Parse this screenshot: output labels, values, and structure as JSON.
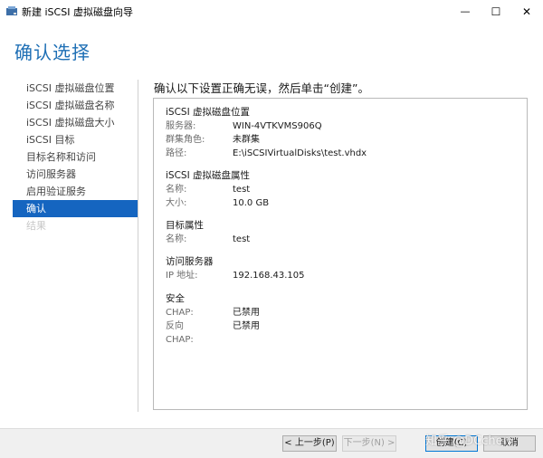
{
  "window": {
    "title": "新建 iSCSI 虚拟磁盘向导",
    "minimize_glyph": "—",
    "maximize_glyph": "☐",
    "close_glyph": "✕",
    "icon": "disk-wizard-icon"
  },
  "page_title": "确认选择",
  "nav": {
    "items": [
      {
        "label": "iSCSI 虚拟磁盘位置",
        "state": "normal"
      },
      {
        "label": "iSCSI 虚拟磁盘名称",
        "state": "normal"
      },
      {
        "label": "iSCSI 虚拟磁盘大小",
        "state": "normal"
      },
      {
        "label": "iSCSI 目标",
        "state": "normal"
      },
      {
        "label": "目标名称和访问",
        "state": "normal"
      },
      {
        "label": "访问服务器",
        "state": "normal"
      },
      {
        "label": "启用验证服务",
        "state": "normal"
      },
      {
        "label": "确认",
        "state": "active"
      },
      {
        "label": "结果",
        "state": "disabled"
      }
    ]
  },
  "heading": "确认以下设置正确无误，然后单击“创建”。",
  "summary": {
    "location": {
      "title": "iSCSI 虚拟磁盘位置",
      "rows": [
        {
          "key": "服务器:",
          "value": "WIN-4VTKVMS906Q"
        },
        {
          "key": "群集角色:",
          "value": "未群集"
        },
        {
          "key": "路径:",
          "value": "E:\\iSCSIVirtualDisks\\test.vhdx"
        }
      ]
    },
    "properties": {
      "title": "iSCSI 虚拟磁盘属性",
      "rows": [
        {
          "key": "名称:",
          "value": "test"
        },
        {
          "key": "大小:",
          "value": "10.0 GB"
        }
      ]
    },
    "target": {
      "title": "目标属性",
      "rows": [
        {
          "key": "名称:",
          "value": "test"
        }
      ]
    },
    "access": {
      "title": "访问服务器",
      "rows": [
        {
          "key": "IP 地址:",
          "value": "192.168.43.105"
        }
      ]
    },
    "security": {
      "title": "安全",
      "rows": [
        {
          "key": "CHAP:",
          "value": "已禁用"
        },
        {
          "key": "反向 CHAP:",
          "value": "已禁用"
        }
      ]
    }
  },
  "buttons": {
    "previous": "< 上一步(P)",
    "next": "下一步(N) >",
    "create": "创建(C)",
    "cancel": "取消"
  },
  "watermark": "知乎 @DCchen",
  "colors": {
    "accent": "#1565c0",
    "title_blue": "#1e6fb5"
  }
}
